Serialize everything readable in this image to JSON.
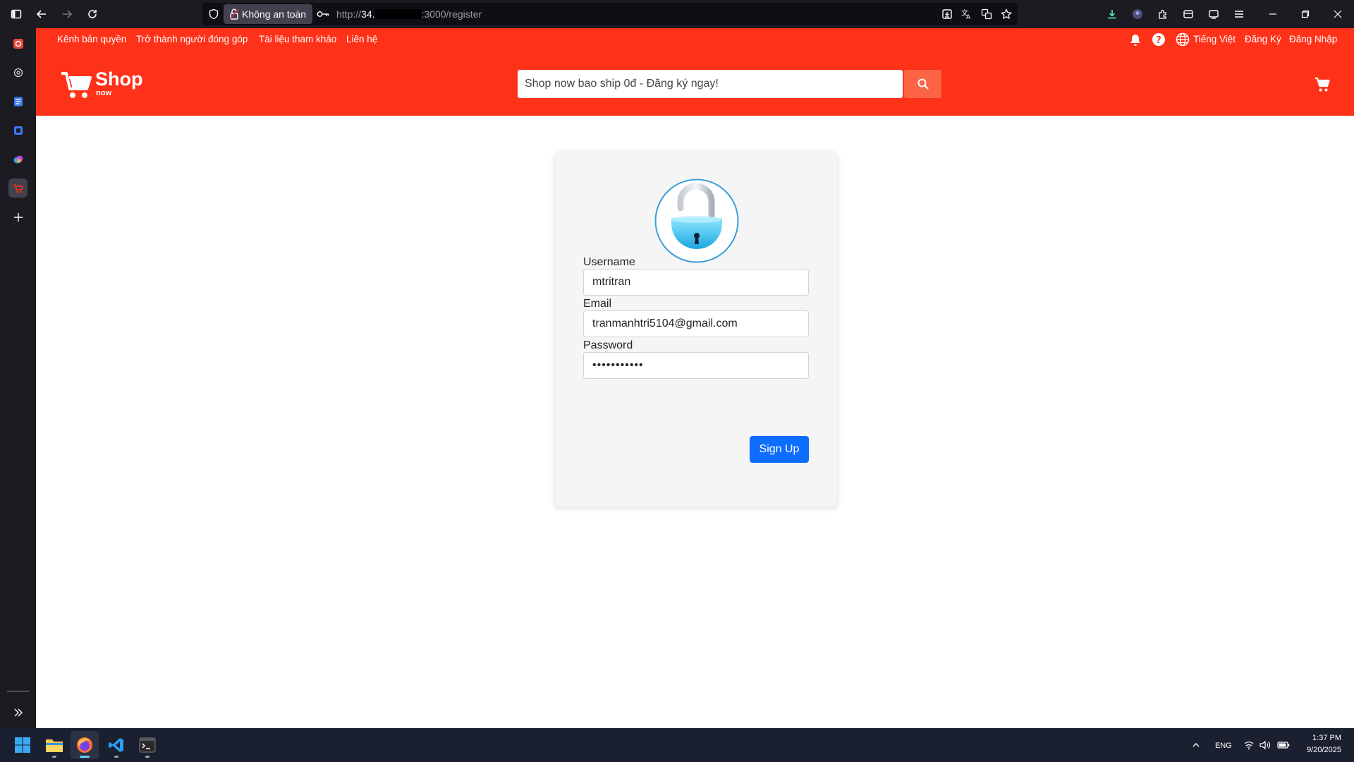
{
  "browser": {
    "security_label": "Không an toàn",
    "url_prefix": "http://",
    "url_host_start": "34.",
    "url_rest": ":3000/register"
  },
  "site": {
    "top_links": [
      "Kênh bản quyền",
      "Trở thành người đóng góp",
      "Tài liệu tham khảo",
      "Liên hệ"
    ],
    "language": "Tiếng Việt",
    "register_link": "Đăng Ký",
    "login_link": "Đăng Nhập",
    "logo_text": "Shop",
    "logo_sub": "now",
    "search_placeholder": "Shop now bao ship 0đ - Đăng ký ngay!"
  },
  "form": {
    "username_label": "Username",
    "username_value": "mtritran",
    "email_label": "Email",
    "email_value": "tranmanhtri5104@gmail.com",
    "password_label": "Password",
    "password_value": "tranmanhtri",
    "submit_label": "Sign Up"
  },
  "taskbar": {
    "language": "ENG",
    "time": "1:37 PM",
    "date": "9/20/2025"
  },
  "colors": {
    "header_bg": "#fe3219",
    "search_button": "#fb6445",
    "primary_button": "#0d6efd",
    "card_bg": "#f5f5f5"
  }
}
